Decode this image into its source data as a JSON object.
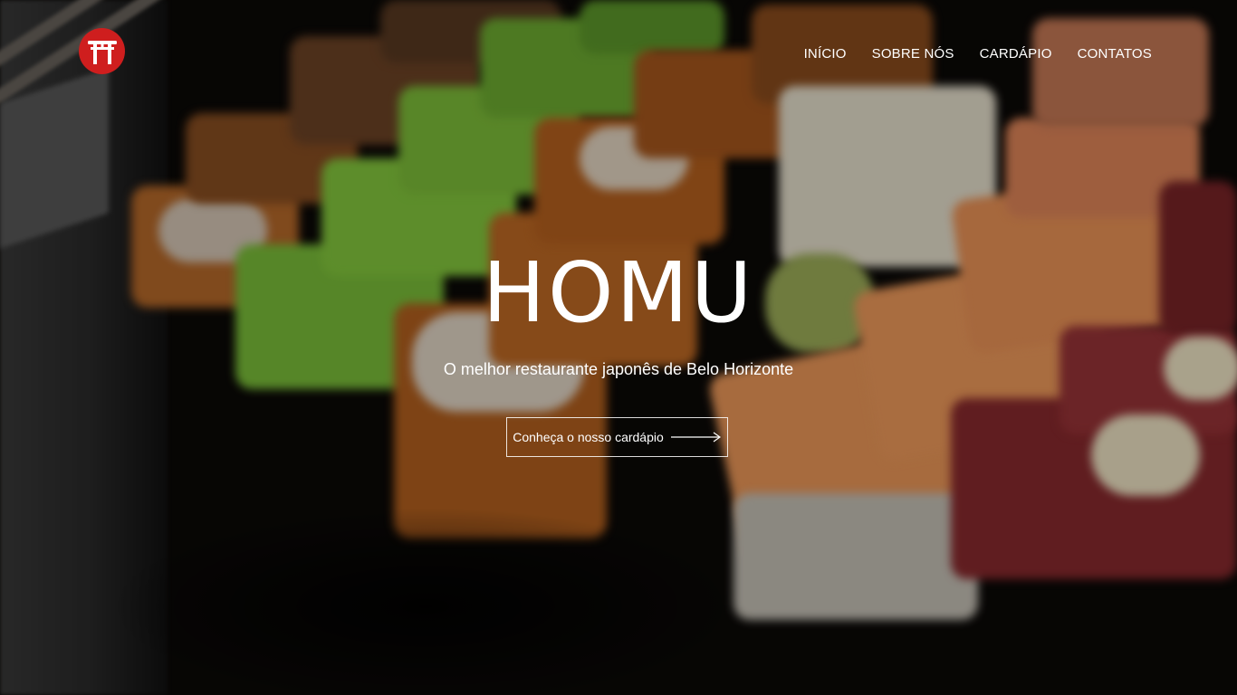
{
  "brand": {
    "logo_icon": "torii-gate-icon",
    "logo_color": "#cf1e1e"
  },
  "nav": {
    "items": [
      {
        "label": "INÍCIO"
      },
      {
        "label": "SOBRE NÓS"
      },
      {
        "label": "CARDÁPIO"
      },
      {
        "label": "CONTATOS"
      }
    ]
  },
  "hero": {
    "title": "HOMU",
    "subtitle": "O melhor restaurante japonês de Belo Horizonte",
    "cta_label": "Conheça o nosso cardápio",
    "cta_icon": "arrow-right-icon"
  }
}
